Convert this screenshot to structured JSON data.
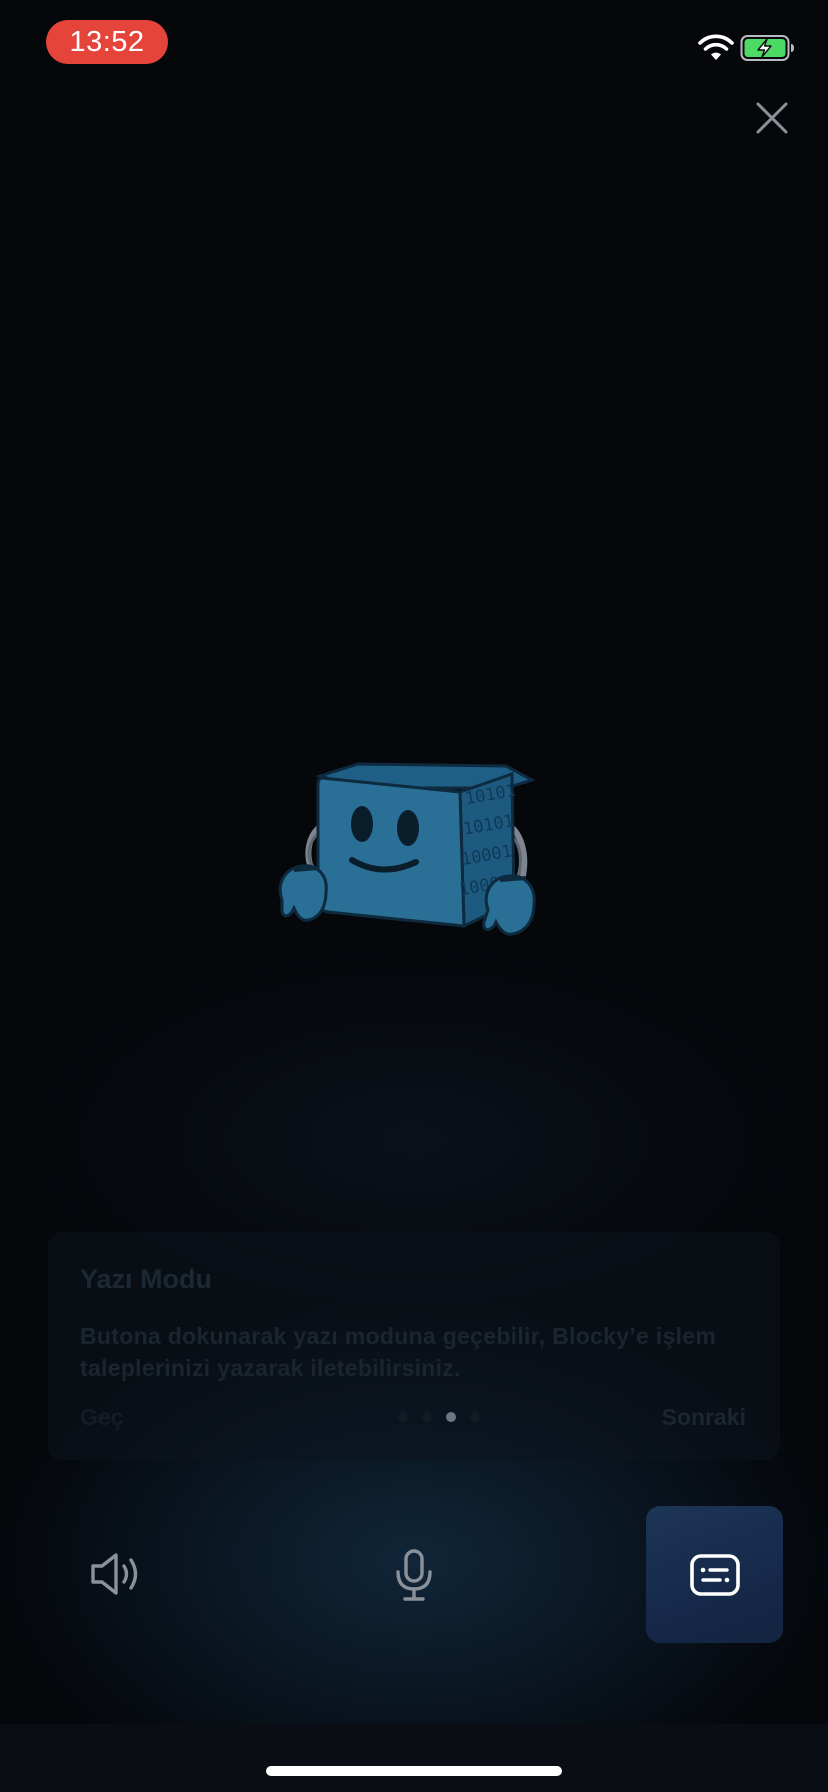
{
  "status_bar": {
    "time": "13:52",
    "time_pill_color": "#e5443b",
    "icons": [
      "wifi-icon",
      "battery-charging-icon"
    ]
  },
  "header": {
    "close_icon": "close-icon"
  },
  "mascot": {
    "icon": "blocky-cube-mascot",
    "binary_text": [
      "10101",
      "10101",
      "10001",
      "10001"
    ]
  },
  "tooltip": {
    "title": "Yazı Modu",
    "body": "Butona dokunarak yazı moduna geçebilir, Blocky’e işlem taleplerinizi yazarak iletebilirsiniz.",
    "skip_label": "Geç",
    "next_label": "Sonraki",
    "page_count": 4,
    "active_page": 3
  },
  "controls": {
    "speaker_icon": "speaker-icon",
    "mic_icon": "microphone-icon",
    "keyboard_icon": "keyboard-message-icon",
    "accent": "#1d3556"
  }
}
